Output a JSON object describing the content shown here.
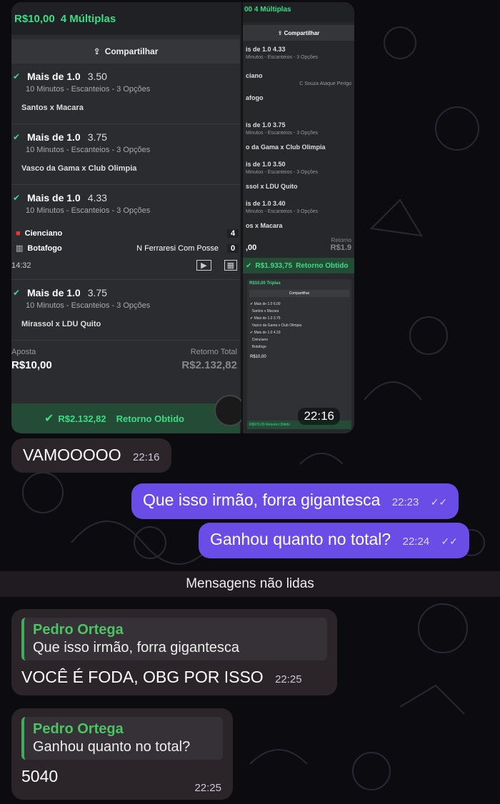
{
  "image_message": {
    "bet": {
      "stake_header": "R$10,00",
      "kind": "4 Múltiplas",
      "share_label": "Compartilhar",
      "legs": [
        {
          "market": "Mais de 1.0",
          "odd": "3.50",
          "detail": "10 Minutos - Escanteios - 3 Opções",
          "match": "Santos x Macara"
        },
        {
          "market": "Mais de 1.0",
          "odd": "3.75",
          "detail": "10 Minutos - Escanteios - 3 Opções",
          "match": "Vasco da Gama x Club Olimpia"
        },
        {
          "market": "Mais de 1.0",
          "odd": "4.33",
          "detail": "10 Minutos - Escanteios - 3 Opções",
          "match": ""
        },
        {
          "market": "Mais de 1.0",
          "odd": "3.75",
          "detail": "10 Minutos - Escanteios - 3 Opções",
          "match": "Mirassol x LDU Quito"
        }
      ],
      "live": {
        "team1": "Cienciano",
        "score1": "4",
        "team2": "Botafogo",
        "score2": "0",
        "event": "N Ferraresi Com Posse",
        "clock": "14:32"
      },
      "stake_label": "Aposta",
      "stake_value": "R$10,00",
      "return_label": "Retorno Total",
      "return_value": "R$2.132,82",
      "won_label": "R$2.132,82",
      "won_text": "Retorno Obtido"
    },
    "second": {
      "header": "00  4 Múltiplas",
      "share_label": "Compartilhar",
      "lines": [
        {
          "title": "is de 1.0  4.33",
          "sub": "Minutos - Escanteios - 3 Opções"
        },
        {
          "title": "ciano",
          "sub": "C Souza Ataque Perigo"
        },
        {
          "title": "afogo",
          "sub": ""
        },
        {
          "title": "is de 1.0  3.75",
          "sub": "Minutos - Escanteios - 3 Opções"
        },
        {
          "title": "o da Gama x Club Olimpia",
          "sub": ""
        },
        {
          "title": "is de 1.0  3.50",
          "sub": "Minutos - Escanteios - 3 Opções"
        },
        {
          "title": "ssol x LDU Quito",
          "sub": ""
        },
        {
          "title": "is de 1.0  3.40",
          "sub": "Minutos - Escanteios - 3 Opções"
        },
        {
          "title": "os x Macara",
          "sub": ""
        }
      ],
      "stake_value": ",00",
      "return_label": "Retorno",
      "return_value": "R$1.9",
      "won_label": "R$1.933,75",
      "won_text": "Retorno Obtido",
      "mini_header": "R$10,00  Triplas",
      "mini_share": "Compartilhar",
      "mini_won": "R$976,00  Retorno Obtido",
      "mini_stake": "R$10,00"
    },
    "time": "22:16"
  },
  "messages": [
    {
      "text": "VAMOOOOO",
      "time": "22:16"
    },
    {
      "text": "Que isso irmão, forra gigantesca",
      "time": "22:23"
    },
    {
      "text": "Ganhou quanto no total?",
      "time": "22:24"
    }
  ],
  "unread_divider": "Mensagens não lidas",
  "replies": [
    {
      "author": "Pedro Ortega",
      "quoted": "Que isso irmão, forra gigantesca",
      "text": "VOCÊ É FODA, OBG POR ISSO",
      "time": "22:25"
    },
    {
      "author": "Pedro Ortega",
      "quoted": "Ganhou quanto no total?",
      "text": "5040",
      "time": "22:25"
    }
  ],
  "colors": {
    "outgoing": "#6a4ce6",
    "incoming": "#2b2529",
    "accent_green": "#3ddc84",
    "reply_author": "#4bc462"
  }
}
